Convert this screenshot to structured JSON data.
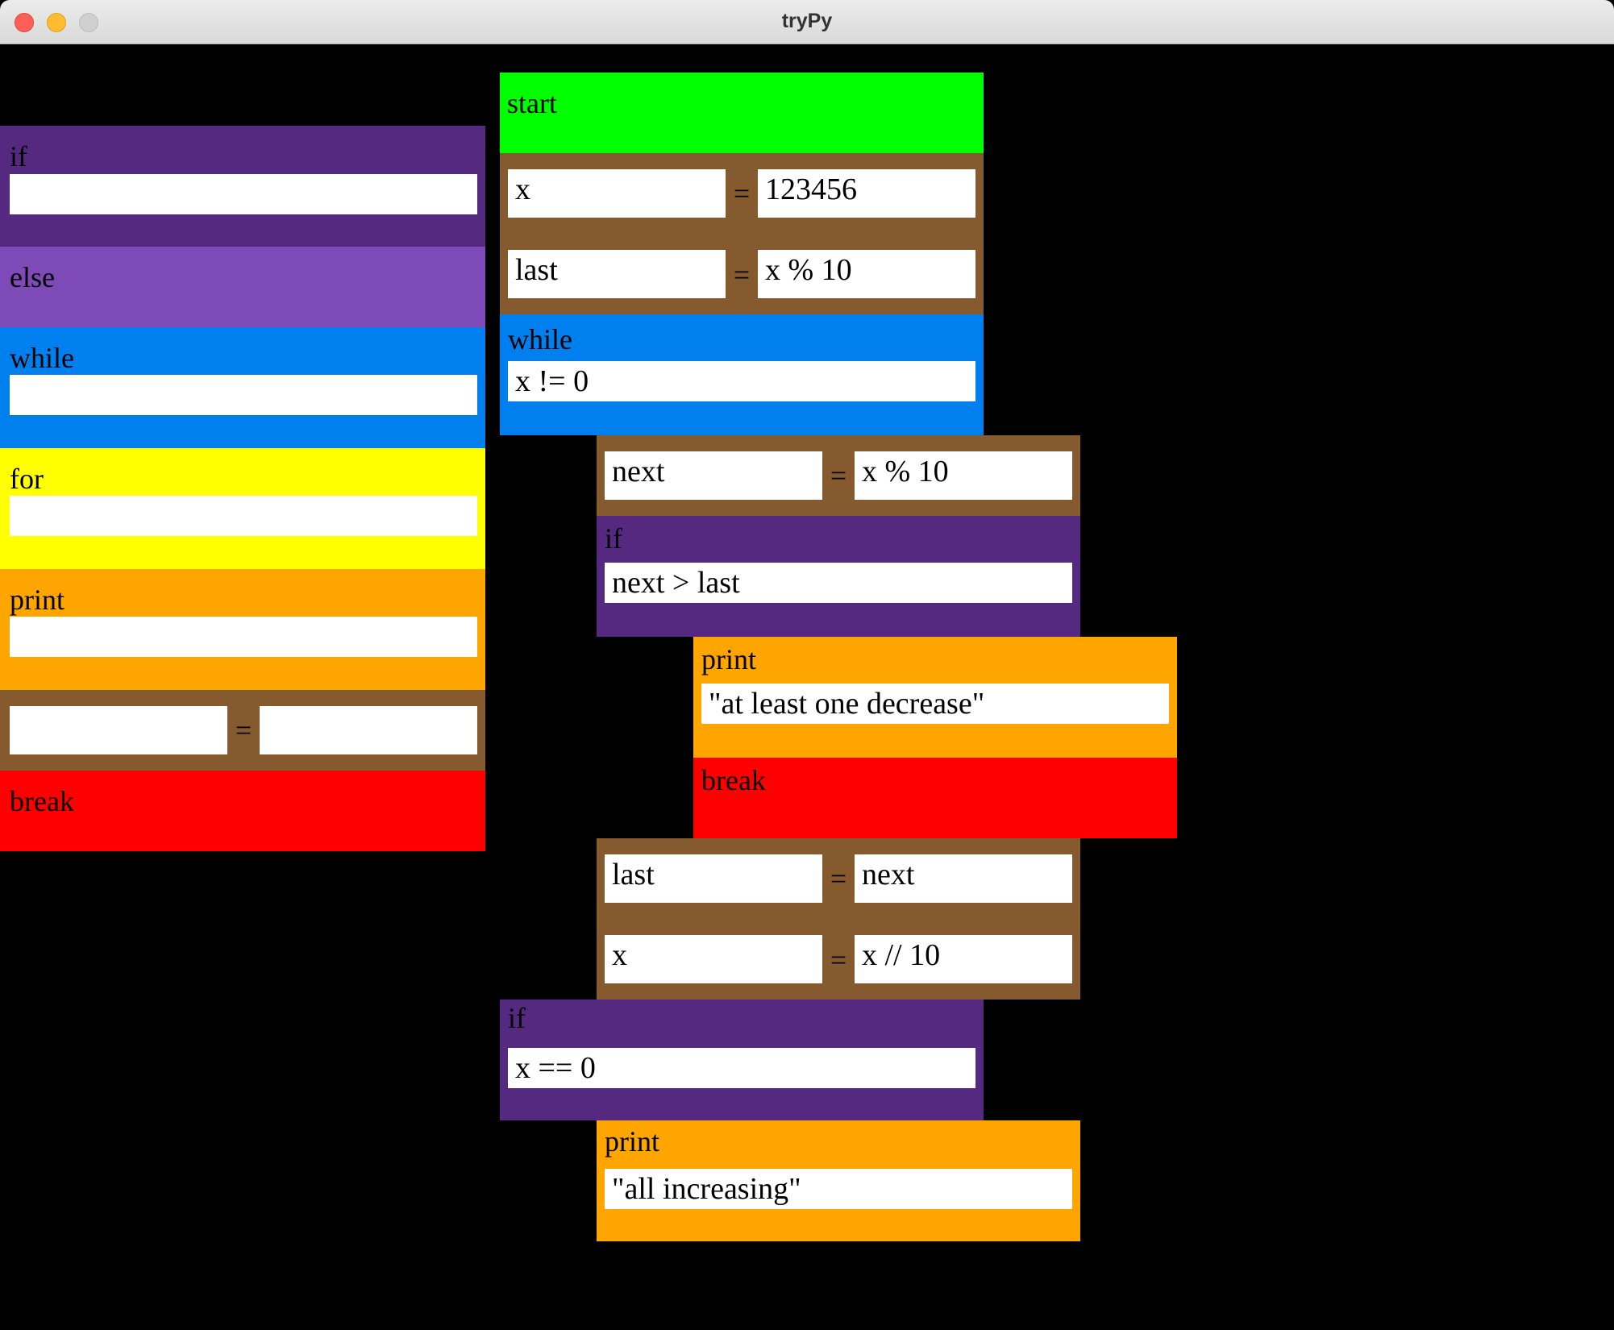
{
  "window": {
    "title": "tryPy"
  },
  "palette": {
    "header": "if",
    "header_value": "",
    "else": "else",
    "while": "while",
    "while_value": "",
    "for": "for",
    "for_value": "",
    "print": "print",
    "print_value": "",
    "assign_equals": "=",
    "assign_left": "",
    "assign_right": "",
    "break": "break"
  },
  "program": {
    "start": "start",
    "assign1": {
      "left": "x",
      "right": "123456",
      "left2": "last",
      "right2": "x % 10",
      "equals": "="
    },
    "while": {
      "label": "while",
      "cond": "x != 0"
    },
    "assign2": {
      "left": "next",
      "right": "x % 10",
      "equals": "="
    },
    "if1": {
      "label": "if",
      "cond": "next > last"
    },
    "print1": {
      "label": "print",
      "value": "\"at least one decrease\""
    },
    "break1": {
      "label": "break"
    },
    "assign3": {
      "left": "last",
      "right": "next",
      "left2": "x",
      "right2": "x // 10",
      "equals": "="
    },
    "if2": {
      "label": "if",
      "cond": "x == 0"
    },
    "print2": {
      "label": "print",
      "value": "\"all increasing\""
    }
  },
  "colors": {
    "if": "#55297f",
    "else": "#7e4ab8",
    "while": "#0080ef",
    "for": "#ffff00",
    "print": "#ffa500",
    "assign": "#855a2e",
    "break": "#ff0000",
    "start": "#00ff00",
    "background": "#000000"
  }
}
